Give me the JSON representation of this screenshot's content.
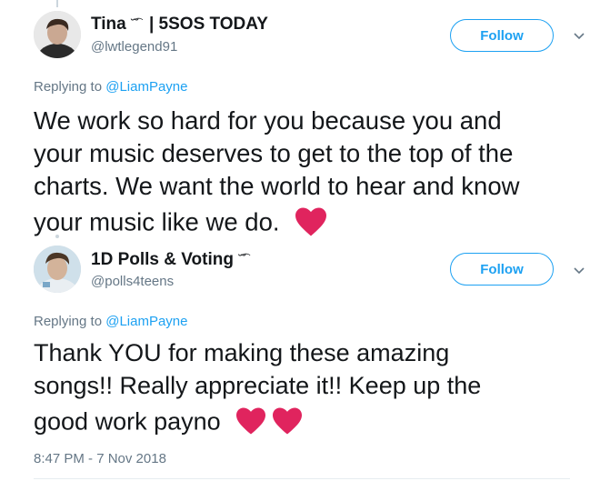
{
  "tweet1": {
    "display_name": "Tina",
    "name_suffix": "| 5SOS TODAY",
    "handle": "@lwtlegend91",
    "follow_label": "Follow",
    "replying_prefix": "Replying to ",
    "replying_to": "@LiamPayne",
    "body_lines": [
      "We work so hard for you because you and",
      "your music deserves to get to the top of the",
      "charts. We want the world to hear and know",
      "your music like we do."
    ]
  },
  "tweet2": {
    "display_name": "1D Polls & Voting",
    "handle": "@polls4teens",
    "follow_label": "Follow",
    "replying_prefix": "Replying to ",
    "replying_to": "@LiamPayne",
    "body_lines": [
      "Thank YOU for making these amazing",
      "songs!! Really appreciate it!! Keep up the",
      "good work payno"
    ],
    "timestamp": "8:47 PM - 7 Nov 2018"
  },
  "colors": {
    "accent": "#1da1f2",
    "secondary_text": "#657786",
    "heart": "#e0245e"
  },
  "icons": [
    "emoticon-icon",
    "chevron-down-icon",
    "heart-icon"
  ]
}
